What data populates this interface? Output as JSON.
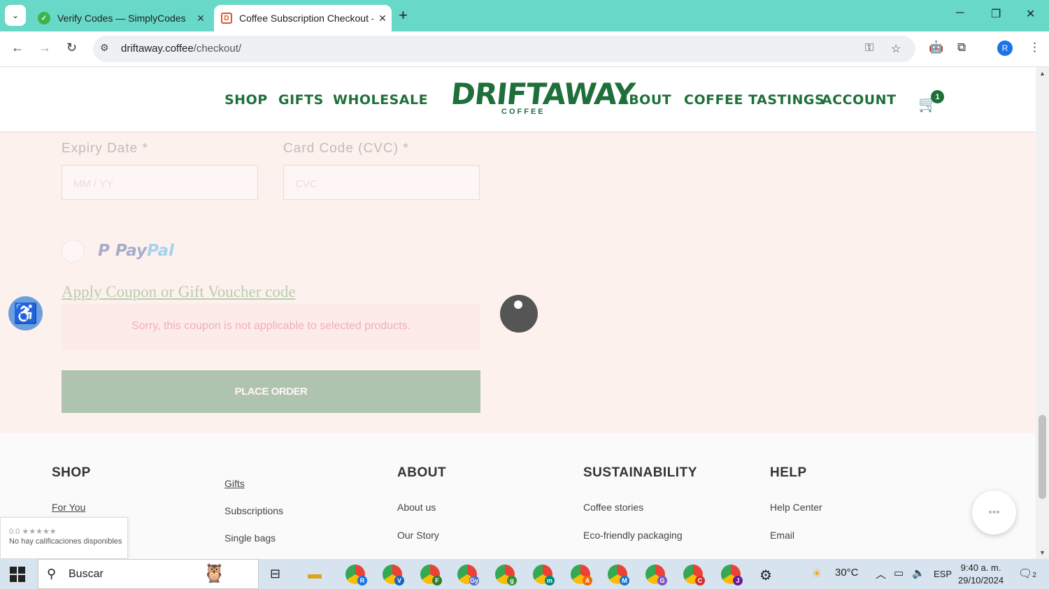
{
  "browser": {
    "tabs": [
      {
        "title": "Verify Codes — SimplyCodes",
        "active": false
      },
      {
        "title": "Coffee Subscription Checkout -",
        "active": true
      }
    ],
    "url_domain": "driftaway.coffee",
    "url_path": "/checkout/",
    "profile_initial": "R"
  },
  "header": {
    "nav_left": [
      "SHOP",
      "GIFTS",
      "WHOLESALE"
    ],
    "logo_main": "DRIFTAWAY",
    "logo_sub": "COFFEE",
    "nav_right": [
      "ABOUT",
      "COFFEE TASTINGS",
      "ACCOUNT"
    ],
    "cart_count": "1"
  },
  "checkout": {
    "expiry_label": "Expiry Date",
    "expiry_placeholder": "MM / YY",
    "cvc_label": "Card Code (CVC)",
    "cvc_placeholder": "CVC",
    "required_mark": "*",
    "paypal_pay": "Pay",
    "paypal_pal": "Pal",
    "coupon_link": "Apply Coupon or Gift Voucher code",
    "error_message": "Sorry, this coupon is not applicable to selected products.",
    "place_order": "PLACE ORDER"
  },
  "footer": {
    "shop_heading": "SHOP",
    "shop_links": [
      "For You"
    ],
    "shop_links2": [
      "Gifts",
      "Subscriptions",
      "Single bags"
    ],
    "about_heading": "ABOUT",
    "about_links": [
      "About us",
      "Our Story"
    ],
    "sustainability_heading": "SUSTAINABILITY",
    "sustainability_links": [
      "Coffee stories",
      "Eco-friendly packaging"
    ],
    "help_heading": "HELP",
    "help_links": [
      "Help Center",
      "Email"
    ]
  },
  "rating_widget": {
    "score": "0.0 ★★★★★",
    "text": "No hay calificaciones disponibles"
  },
  "taskbar": {
    "search_text": "Buscar",
    "chrome_profiles": [
      "R",
      "V",
      "F",
      "Gy",
      "g",
      "m",
      "A",
      "M",
      "G",
      "C",
      "J"
    ],
    "weather": "30°C",
    "language": "ESP",
    "time": "9:40 a. m.",
    "date": "29/10/2024",
    "notifications": "2"
  },
  "colors": {
    "brand_green": "#1f6f3a",
    "tabbar": "#68d8c8",
    "error_text": "#d6324a",
    "page_bg": "#fdf1ee"
  }
}
